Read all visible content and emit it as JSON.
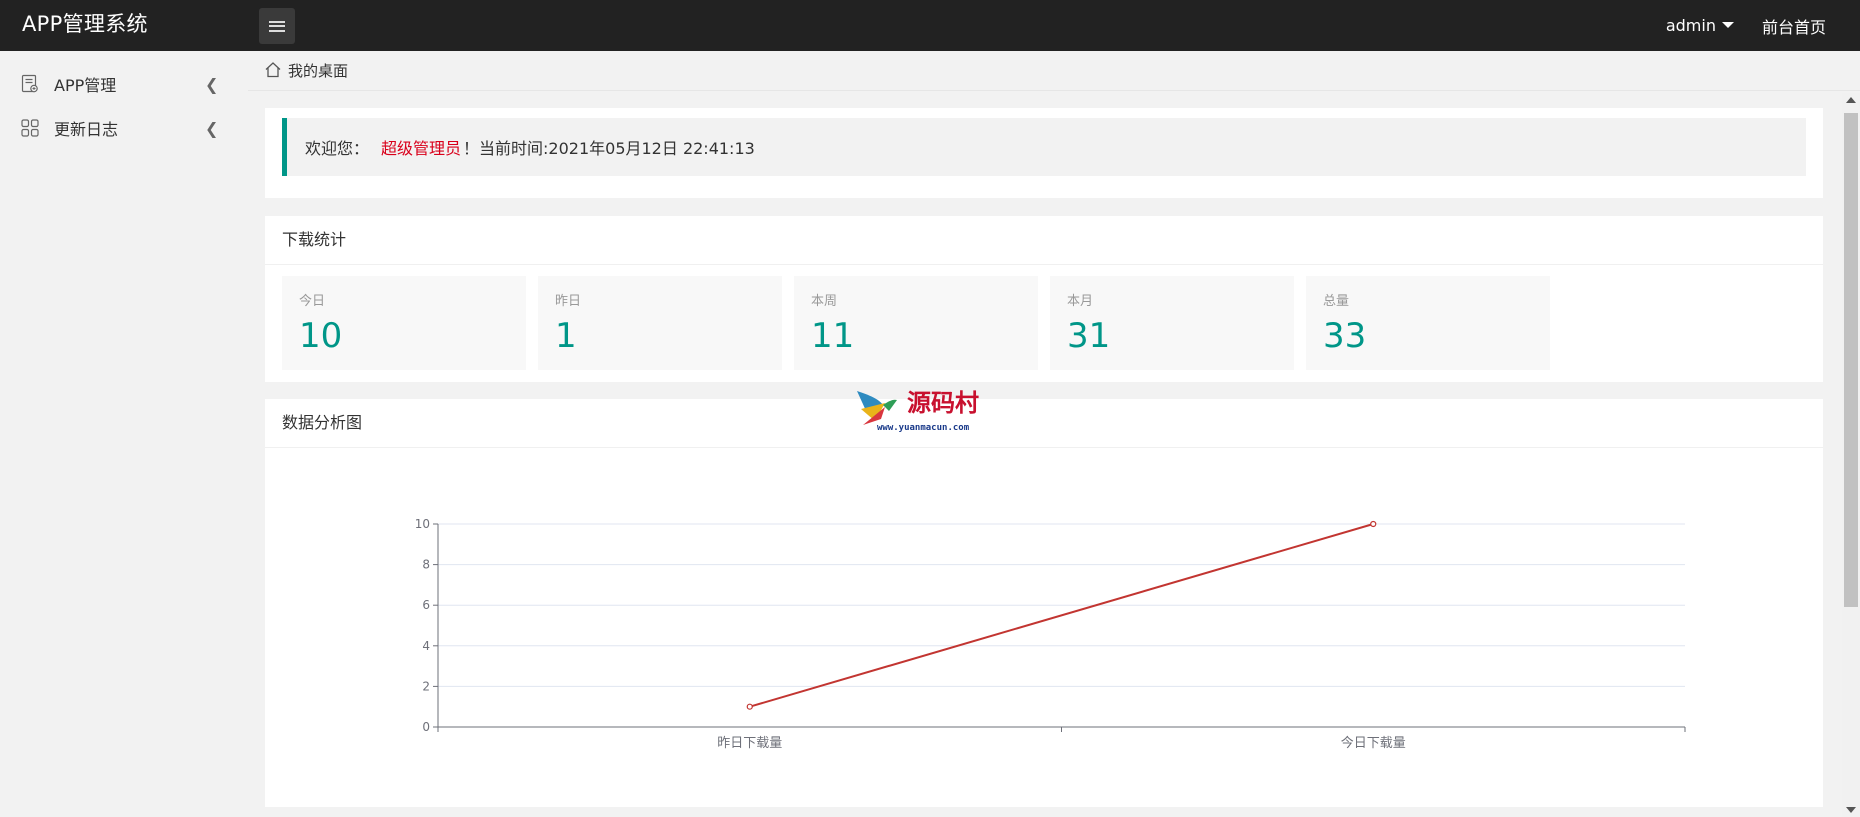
{
  "header": {
    "logo": "APP管理系统",
    "user": "admin",
    "home_link": "前台首页"
  },
  "sidebar": {
    "items": [
      {
        "label": "APP管理",
        "icon": "app-doc-icon"
      },
      {
        "label": "更新日志",
        "icon": "grid-icon"
      }
    ]
  },
  "breadcrumb": {
    "label": "我的桌面",
    "icon": "home-icon"
  },
  "welcome": {
    "prefix": "欢迎您：",
    "name": "超级管理员",
    "suffix": "！当前时间:2021年05月12日 22:41:13"
  },
  "stats": {
    "title": "下载统计",
    "items": [
      {
        "label": "今日",
        "value": "10"
      },
      {
        "label": "昨日",
        "value": "1"
      },
      {
        "label": "本周",
        "value": "11"
      },
      {
        "label": "本月",
        "value": "31"
      },
      {
        "label": "总量",
        "value": "33"
      }
    ]
  },
  "chart_section": {
    "title": "数据分析图"
  },
  "watermark": {
    "cn": "源码村",
    "url": "www.yuanmacun.com"
  },
  "colors": {
    "accent": "#009688",
    "header_bg": "#222222",
    "line": "#c23531",
    "admin_name": "#d9001b"
  },
  "chart_data": {
    "type": "line",
    "categories": [
      "昨日下载量",
      "今日下载量"
    ],
    "series": [
      {
        "values": [
          1,
          10
        ]
      }
    ],
    "ylim": [
      0,
      10
    ],
    "yticks": [
      0,
      2,
      4,
      6,
      8,
      10
    ],
    "grid": true
  }
}
